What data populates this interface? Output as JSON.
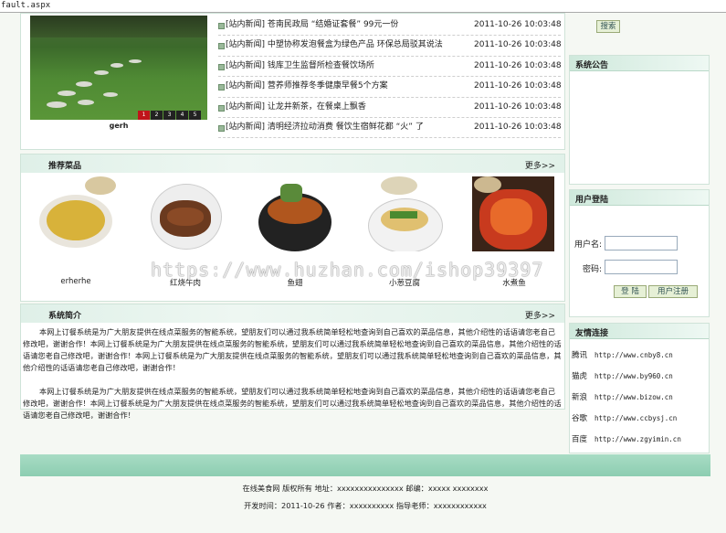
{
  "address_bar": "fault.aspx",
  "slideshow": {
    "caption": "gerh",
    "pages": [
      "1",
      "2",
      "3",
      "4",
      "5"
    ],
    "active_page": "1"
  },
  "news": [
    {
      "tag": "[站内新闻]",
      "title": "苍南民政局 “结婚证套餐” 99元一份",
      "date": "2011-10-26 10:03:48"
    },
    {
      "tag": "[站内新闻]",
      "title": "中塑协称发泡餐盒为绿色产品 环保总局驳其说法",
      "date": "2011-10-26 10:03:48"
    },
    {
      "tag": "[站内新闻]",
      "title": "钱库卫生监督所检查餐饮场所",
      "date": "2011-10-26 10:03:48"
    },
    {
      "tag": "[站内新闻]",
      "title": "营养师推荐冬季健康早餐5个方案",
      "date": "2011-10-26 10:03:48"
    },
    {
      "tag": "[站内新闻]",
      "title": "让龙井新茶，在餐桌上飘香",
      "date": "2011-10-26 10:03:48"
    },
    {
      "tag": "[站内新闻]",
      "title": "清明经济拉动消费 餐饮生宿鲜花都 “火” 了",
      "date": "2011-10-26 10:03:48"
    }
  ],
  "recommended": {
    "title": "推荐菜品",
    "more": "更多>>",
    "dishes": [
      {
        "name": "erherhe",
        "icon": "corn-soup-image"
      },
      {
        "name": "红烧牛肉",
        "icon": "braised-beef-image"
      },
      {
        "name": "鱼翅",
        "icon": "hotpot-soup-image"
      },
      {
        "name": "小葱豆腐",
        "icon": "noodle-bowl-image"
      },
      {
        "name": "水煮鱼",
        "icon": "spicy-dish-image"
      }
    ]
  },
  "intro": {
    "title": "系统简介",
    "more": "更多>>",
    "paragraphs": [
      "本网上订餐系统是为广大朋友提供在线点菜服务的智能系统，望朋友们可以通过我系统简单轻松地查询到自己喜欢的菜品信息，其他介绍性的话语请您老自己修改吧，谢谢合作！本网上订餐系统是为广大朋友提供在线点菜服务的智能系统，望朋友们可以通过我系统简单轻松地查询到自己喜欢的菜品信息，其他介绍性的话语请您老自己修改吧，谢谢合作！本网上订餐系统是为广大朋友提供在线点菜服务的智能系统，望朋友们可以通过我系统简单轻松地查询到自己喜欢的菜品信息，其他介绍性的话语请您老自己修改吧，谢谢合作！",
      "本网上订餐系统是为广大朋友提供在线点菜服务的智能系统，望朋友们可以通过我系统简单轻松地查询到自己喜欢的菜品信息，其他介绍性的话语请您老自己修改吧，谢谢合作！本网上订餐系统是为广大朋友提供在线点菜服务的智能系统，望朋友们可以通过我系统简单轻松地查询到自己喜欢的菜品信息，其他介绍性的话语请您老自己修改吧，谢谢合作！"
    ]
  },
  "sidebar": {
    "search_button": "搜索",
    "notice_title": "系统公告",
    "login_title": "用户登陆",
    "username_label": "用户名:",
    "password_label": "密码:",
    "login_button": "登 陆",
    "register_button": "用户注册",
    "links_title": "友情连接",
    "links": [
      {
        "name": "腾讯",
        "url": "http://www.cnby8.cn"
      },
      {
        "name": "猫虎",
        "url": "http://www.by960.cn"
      },
      {
        "name": "新浪",
        "url": "http://www.bizow.cn"
      },
      {
        "name": "谷歌",
        "url": "http://www.ccbysj.cn"
      },
      {
        "name": "百度",
        "url": "http://www.zgyimin.cn"
      }
    ]
  },
  "footer": {
    "line1": "在线美食网 版权所有 地址：xxxxxxxxxxxxxxx 邮编：xxxxx xxxxxxxx",
    "line2": "开发时间：2011-10-26 作者：xxxxxxxxxx 指导老师：xxxxxxxxxxxx"
  },
  "watermark": "https://www.huzhan.com/ishop39397"
}
